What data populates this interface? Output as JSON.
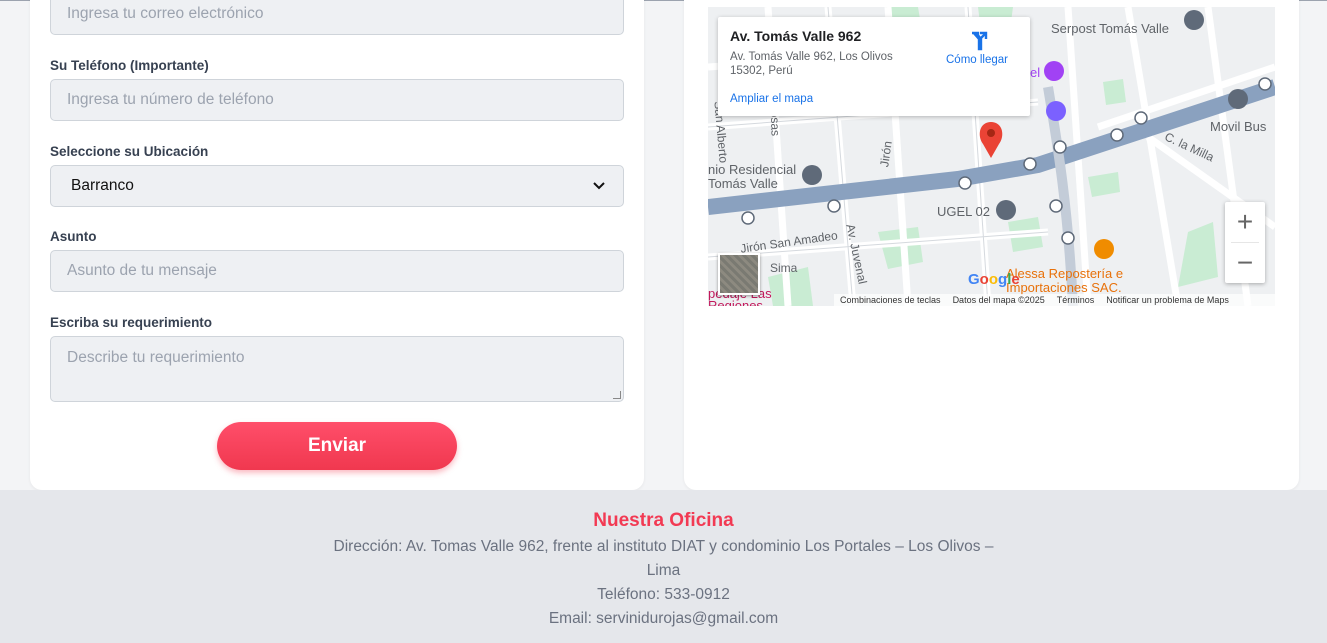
{
  "form": {
    "email_placeholder": "Ingresa tu correo electrónico",
    "phone_label": "Su Teléfono (Importante)",
    "phone_placeholder": "Ingresa tu número de teléfono",
    "location_label": "Seleccione su Ubicación",
    "location_value": "Barranco",
    "subject_label": "Asunto",
    "subject_placeholder": "Asunto de tu mensaje",
    "requirement_label": "Escriba su requerimiento",
    "requirement_placeholder": "Describe tu requerimiento",
    "submit_label": "Enviar"
  },
  "map": {
    "place_title": "Av. Tomás Valle 962",
    "place_address": "Av. Tomás Valle 962, Los Olivos 15302, Perú",
    "directions_label": "Cómo llegar",
    "enlarge_label": "Ampliar el mapa",
    "zoom_in": "+",
    "zoom_out": "−",
    "labels": {
      "serpost": "Serpost Tomás Valle",
      "movil_bus": "Movil Bus",
      "residencial": "nio Residencial\nTomás Valle",
      "ugel": "UGEL 02",
      "san_amadeo": "Jirón San Amadeo",
      "alessa": "Alessa Repostería e\nImportaciones SAC.",
      "la_milla": "C. la Milla",
      "rosas": "Rosas",
      "sima": "Sima",
      "jiron": "Jirón",
      "juvenal": "Av. Juvenal",
      "san_alberto": "San Alberto",
      "regiones": "pedaje Las\nRegiones",
      "el": "el"
    },
    "attribution": {
      "shortcuts": "Combinaciones de teclas",
      "data": "Datos del mapa ©2025",
      "terms": "Términos",
      "report": "Notificar un problema de Maps"
    },
    "google": "Google"
  },
  "footer": {
    "title": "Nuestra Oficina",
    "address_line1": "Dirección: Av. Tomas Valle 962, frente al instituto DIAT y condominio Los Portales – Los Olivos –",
    "address_line2": "Lima",
    "phone": "Teléfono: 533-0912",
    "email": "Email: servinidurojas@gmail.com"
  },
  "colors": {
    "accent": "#f23a53",
    "link": "#1a73e8"
  }
}
